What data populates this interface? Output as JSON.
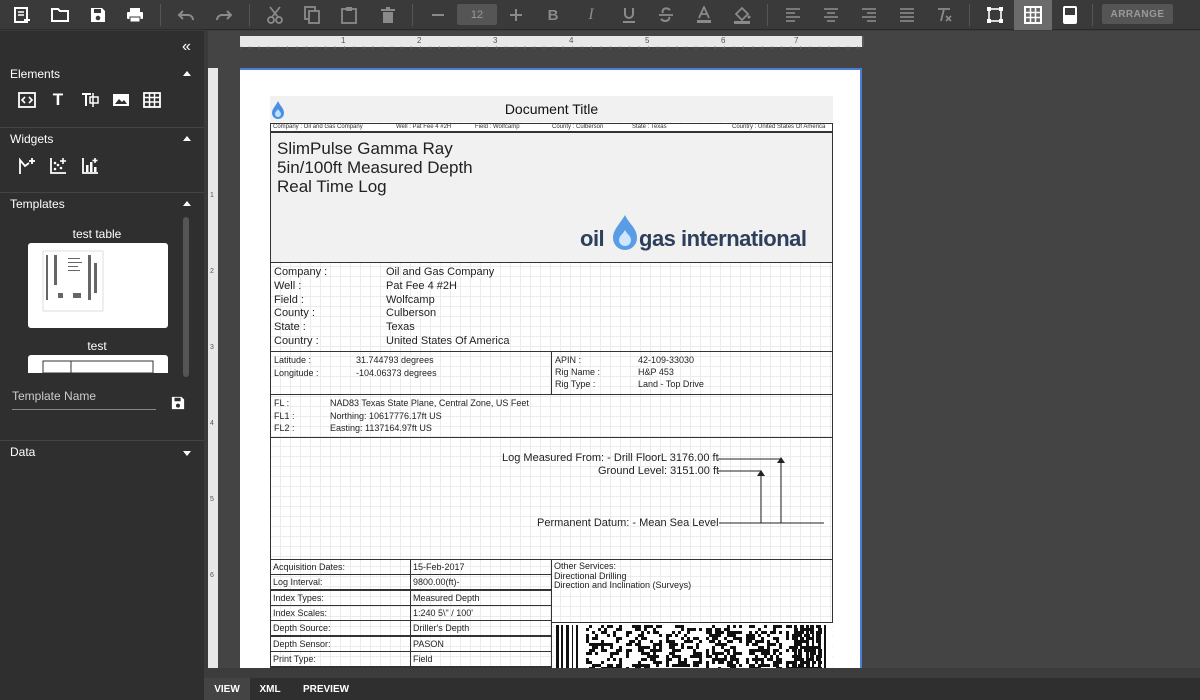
{
  "toolbar": {
    "font_size": "12",
    "arrange_label": "ARRANGE"
  },
  "sidebar": {
    "elements_label": "Elements",
    "widgets_label": "Widgets",
    "templates_label": "Templates",
    "template1_name": "test table",
    "template2_name": "test",
    "template_name_placeholder": "Template Name",
    "data_label": "Data"
  },
  "ruler": {
    "marks": [
      "1",
      "2",
      "3",
      "4",
      "5",
      "6",
      "7"
    ],
    "vmarks": [
      "1",
      "2",
      "3",
      "4",
      "5",
      "6"
    ]
  },
  "document": {
    "title": "Document Title",
    "header_strip": {
      "company": "Company : Oil and Gas Company",
      "well": "Well : Pat Fee 4 #2H",
      "field": "Field : Wolfcamp",
      "county": "County : Culberson",
      "state": "State : Texas",
      "country": "Country : United States Of America"
    },
    "log_title_1": "SlimPulse Gamma Ray",
    "log_title_2": "5in/100ft Measured Depth",
    "log_title_3": "Real Time Log",
    "logo_text_1": "oil",
    "logo_text_2": "gas international",
    "info": [
      {
        "label": "Company :",
        "value": "Oil and Gas Company"
      },
      {
        "label": "Well :",
        "value": "Pat Fee 4 #2H"
      },
      {
        "label": "Field :",
        "value": "Wolfcamp"
      },
      {
        "label": "County :",
        "value": "Culberson"
      },
      {
        "label": "State :",
        "value": "Texas"
      },
      {
        "label": "Country :",
        "value": "United States Of America"
      }
    ],
    "coords_left": [
      {
        "label": "Latitude :",
        "value": "31.744793 degrees"
      },
      {
        "label": "Longitude :",
        "value": "-104.06373 degrees"
      }
    ],
    "coords_right": [
      {
        "label": "APIN :",
        "value": "42-109-33030"
      },
      {
        "label": "Rig Name :",
        "value": "H&P 453"
      },
      {
        "label": "Rig Type :",
        "value": "Land - Top Drive"
      }
    ],
    "fl": [
      {
        "label": "FL :",
        "value": "NAD83 Texas State Plane, Central Zone, US Feet"
      },
      {
        "label": "FL1 :",
        "value": "Northing: 10617776.17ft US"
      },
      {
        "label": "FL2 :",
        "value": "Easting: 1137164.97ft US"
      }
    ],
    "datum": {
      "log_measured": "Log Measured From: - Drill FloorL 3176.00 ft",
      "ground_level": "Ground Level: 3151.00 ft",
      "permanent_datum": "Permanent Datum: - Mean Sea Level"
    },
    "acquisition": [
      {
        "label": "Acquisition Dates:",
        "value": "15-Feb-2017"
      },
      {
        "label": "Log Interval:",
        "value": "9800.00(ft)-"
      },
      {
        "label": "Index Types:",
        "value": "Measured Depth"
      },
      {
        "label": "Index Scales:",
        "value": "1:240 5\\\" / 100'"
      },
      {
        "label": "Depth Source:",
        "value": "Driller's Depth"
      },
      {
        "label": "Depth Sensor:",
        "value": "PASON"
      },
      {
        "label": "Print Type:",
        "value": "Field"
      }
    ],
    "other_services": [
      "Other Services:",
      "Directional Drilling",
      "Direction and Inclination (Surveys)"
    ]
  },
  "bottom_tabs": {
    "view": "VIEW",
    "xml": "XML",
    "preview": "PREVIEW"
  }
}
